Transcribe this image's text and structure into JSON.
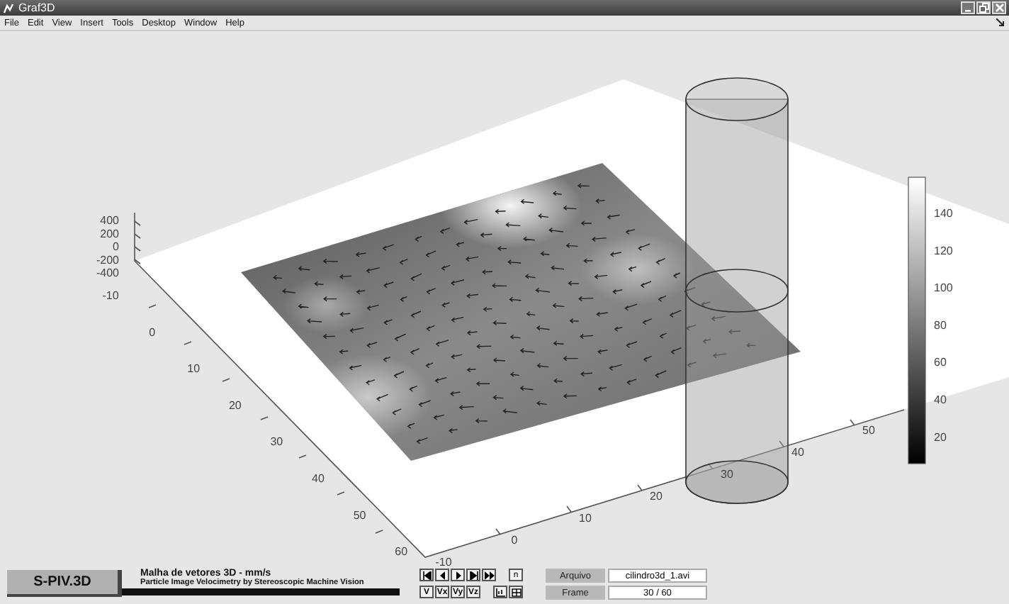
{
  "window": {
    "title": "Graf3D"
  },
  "menu": [
    "File",
    "Edit",
    "View",
    "Insert",
    "Tools",
    "Desktop",
    "Window",
    "Help"
  ],
  "plot": {
    "z_ticks": [
      "400",
      "200",
      "0",
      "-200",
      "-400"
    ],
    "y_ticks": [
      "-10",
      "0",
      "10",
      "20",
      "30",
      "40",
      "50",
      "60"
    ],
    "x_ticks": [
      "-10",
      "0",
      "10",
      "20",
      "30",
      "40",
      "50"
    ],
    "colorbar_ticks": [
      "140",
      "120",
      "100",
      "80",
      "60",
      "40",
      "20"
    ]
  },
  "panel": {
    "logo": "S-PIV.3D",
    "title": "Malha de vetores 3D  - mm/s",
    "subtitle": "Particle Image Velocimetry by Stereoscopic Machine Vision",
    "n_button": "n",
    "component_buttons": [
      "V",
      "Vx",
      "Vy",
      "Vz"
    ],
    "file_label": "Arquivo",
    "file_value": "cilindro3d_1.avi",
    "frame_label": "Frame",
    "frame_value": "30 / 60"
  }
}
